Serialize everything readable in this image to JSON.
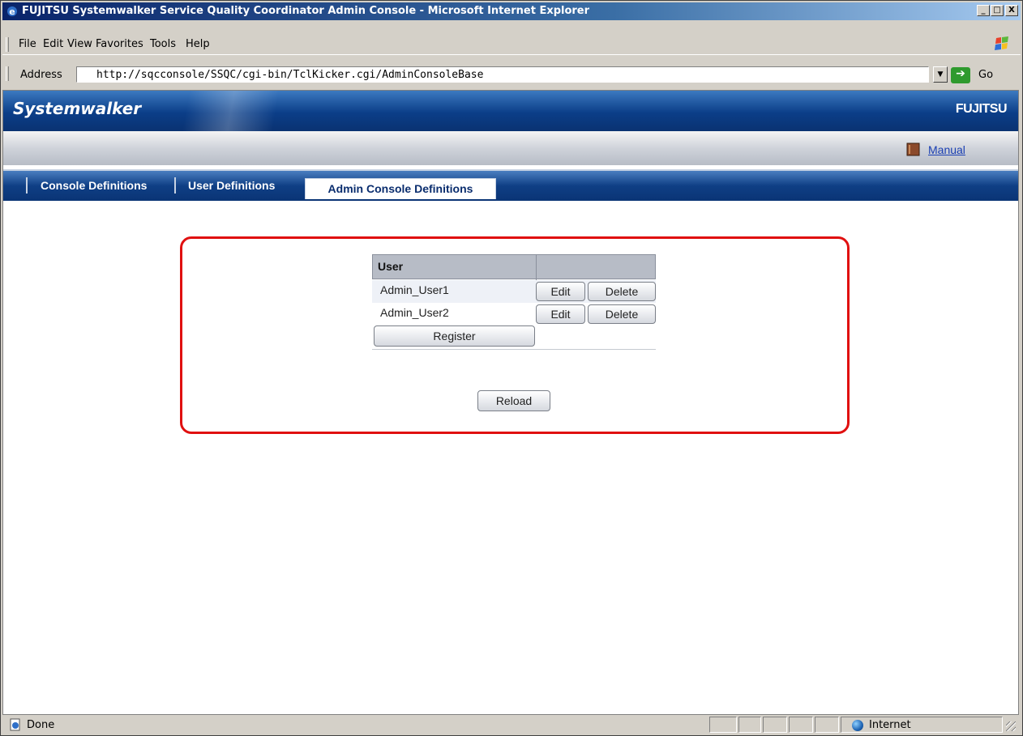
{
  "window": {
    "title": "FUJITSU Systemwalker Service Quality Coordinator Admin Console - Microsoft Internet Explorer",
    "minimize_glyph": "_",
    "maximize_glyph": "□",
    "close_glyph": "X"
  },
  "menu": {
    "items": [
      "File",
      "Edit",
      "View",
      "Favorites",
      "Tools",
      "Help"
    ]
  },
  "address": {
    "label": "Address",
    "url": "http://sqcconsole/SSQC/cgi-bin/TclKicker.cgi/AdminConsoleBase",
    "go_label": "Go"
  },
  "header": {
    "product_logo": "Systemwalker",
    "brand_logo": "FUJITSU",
    "manual_link": "Manual"
  },
  "tabs": [
    {
      "label": "Console Definitions",
      "active": false
    },
    {
      "label": "User Definitions",
      "active": false
    },
    {
      "label": "Admin Console Definitions",
      "active": true
    }
  ],
  "users_table": {
    "header": "User",
    "rows": [
      {
        "name": "Admin_User1",
        "edit_label": "Edit",
        "delete_label": "Delete"
      },
      {
        "name": "Admin_User2",
        "edit_label": "Edit",
        "delete_label": "Delete"
      }
    ],
    "register_label": "Register"
  },
  "reload_label": "Reload",
  "status": {
    "text": "Done",
    "zone": "Internet"
  },
  "colors": {
    "highlight_border": "#e01010",
    "banner": "#0b3e88",
    "link": "#1a3fb3"
  }
}
